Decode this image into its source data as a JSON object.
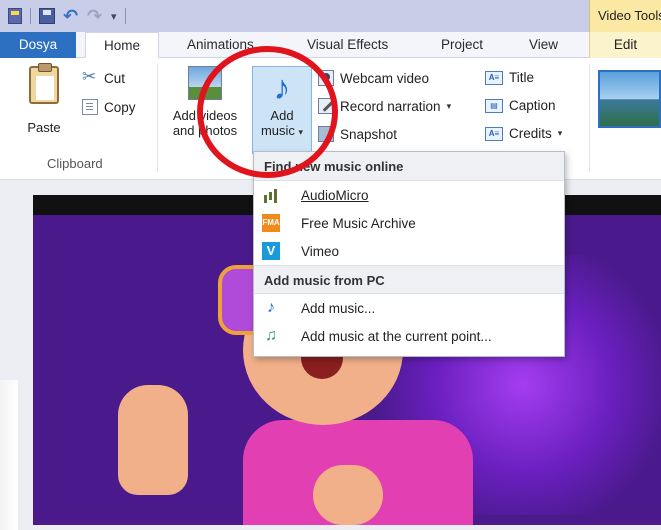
{
  "context_tab": "Video Tools",
  "tabs": {
    "file": "Dosya",
    "home": "Home",
    "animations": "Animations",
    "visual_effects": "Visual Effects",
    "project": "Project",
    "view": "View",
    "edit": "Edit"
  },
  "ribbon": {
    "paste": "Paste",
    "cut": "Cut",
    "copy": "Copy",
    "clipboard_group": "Clipboard",
    "add_videos_line1": "Add videos",
    "add_videos_line2": "and photos",
    "add_music_line1": "Add",
    "add_music_line2": "music",
    "webcam": "Webcam video",
    "record": "Record narration",
    "snapshot": "Snapshot",
    "title": "Title",
    "caption": "Caption",
    "credits": "Credits",
    "title_icon_text": "A≡",
    "caption_icon_text": "▤",
    "credits_icon_text": "A≡"
  },
  "menu": {
    "online_header": "Find new music online",
    "items_online": [
      {
        "icon": "audiomicro-icon",
        "label": "AudioMicro"
      },
      {
        "icon": "fma-icon",
        "label": "Free Music Archive"
      },
      {
        "icon": "vimeo-icon",
        "label": "Vimeo"
      }
    ],
    "pc_header": "Add music from PC",
    "add_music": "Add music...",
    "add_music_current": "Add music at the current point...",
    "fma_badge": "FMA",
    "vimeo_badge": "V"
  },
  "colors": {
    "accent": "#2d6fc0",
    "annotation": "#e0141c",
    "context_tab": "#fbe9a3"
  }
}
